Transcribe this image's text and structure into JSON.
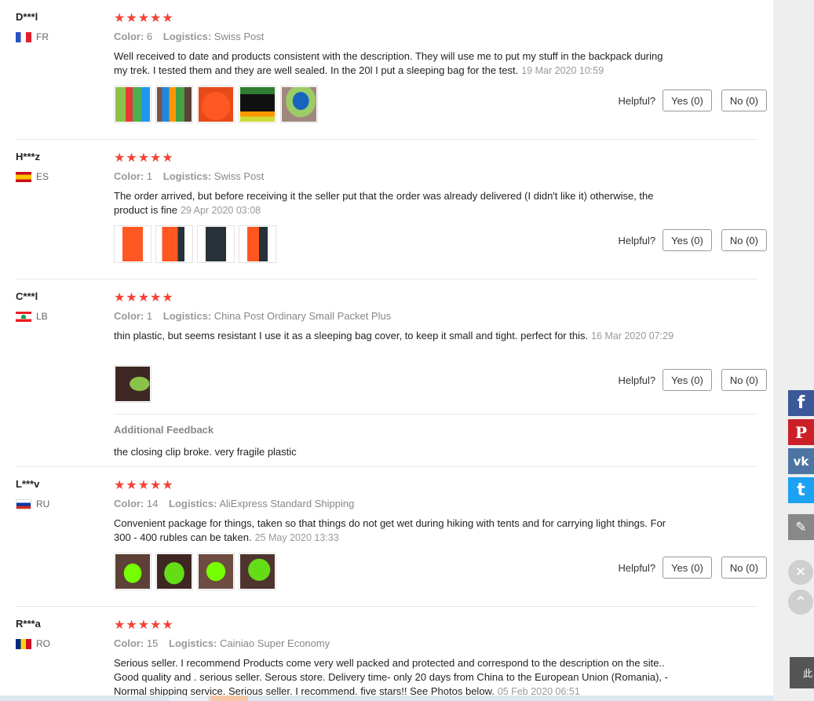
{
  "reviews": [
    {
      "user": "D***l",
      "country": "FR",
      "stars": "★★★★★",
      "color_label": "Color:",
      "color_value": "6",
      "logistics_label": "Logistics:",
      "logistics_value": "Swiss Post",
      "text": "Well received to date and products consistent with the description. They will use me to put my stuff in the backpack during my trek. I tested them and they are well sealed. In the 20l I put a sleeping bag for the test.",
      "date": "19 Mar 2020 10:59",
      "helpful_label": "Helpful?",
      "yes_label": "Yes (0)",
      "no_label": "No (0)",
      "photo_count": 5
    },
    {
      "user": "H***z",
      "country": "ES",
      "stars": "★★★★★",
      "color_label": "Color:",
      "color_value": "1",
      "logistics_label": "Logistics:",
      "logistics_value": "Swiss Post",
      "text": "The order arrived, but before receiving it the seller put that the order was already delivered (I didn't like it) otherwise, the product is fine",
      "date": "29 Apr 2020 03:08",
      "helpful_label": "Helpful?",
      "yes_label": "Yes (0)",
      "no_label": "No (0)",
      "photo_count": 4
    },
    {
      "user": "C***l",
      "country": "LB",
      "stars": "★★★★★",
      "color_label": "Color:",
      "color_value": "1",
      "logistics_label": "Logistics:",
      "logistics_value": "China Post Ordinary Small Packet Plus",
      "text": "thin plastic, but seems resistant I use it as a sleeping bag cover, to keep it small and tight. perfect for this.",
      "date": "16 Mar 2020 07:29",
      "helpful_label": "Helpful?",
      "yes_label": "Yes (0)",
      "no_label": "No (0)",
      "photo_count": 1,
      "additional_title": "Additional Feedback",
      "additional_text": "the closing clip broke. very fragile plastic"
    },
    {
      "user": "L***v",
      "country": "RU",
      "stars": "★★★★★",
      "color_label": "Color:",
      "color_value": "14",
      "logistics_label": "Logistics:",
      "logistics_value": "AliExpress Standard Shipping",
      "text": "Convenient package for things, taken so that things do not get wet during hiking with tents and for carrying light things. For 300 - 400 rubles can be taken.",
      "date": "25 May 2020 13:33",
      "helpful_label": "Helpful?",
      "yes_label": "Yes (0)",
      "no_label": "No (0)",
      "photo_count": 4
    },
    {
      "user": "R***a",
      "country": "RO",
      "stars": "★★★★★",
      "color_label": "Color:",
      "color_value": "15",
      "logistics_label": "Logistics:",
      "logistics_value": "Cainiao Super Economy",
      "text": "Serious seller. I recommend Products come very well packed and protected and correspond to the description on the site.. Good quality and . serious seller. Serous store. Delivery time- only 20 days from China to the European Union (Romania), - Normal shipping service. Serious seller. I recommend. five stars!! See Photos below.",
      "date": "05 Feb 2020 06:51"
    }
  ],
  "share": {
    "facebook": "f",
    "pinterest": "P",
    "vk": "vk",
    "twitter": "t",
    "edit": "✎",
    "close": "✕",
    "up": "⌃",
    "tab_text": "此"
  },
  "colors": {
    "stars": "#f44336",
    "facebook": "#3b5998",
    "pinterest": "#cb2027",
    "vk": "#4c75a3",
    "twitter": "#1da1f2",
    "edit": "#888888"
  }
}
